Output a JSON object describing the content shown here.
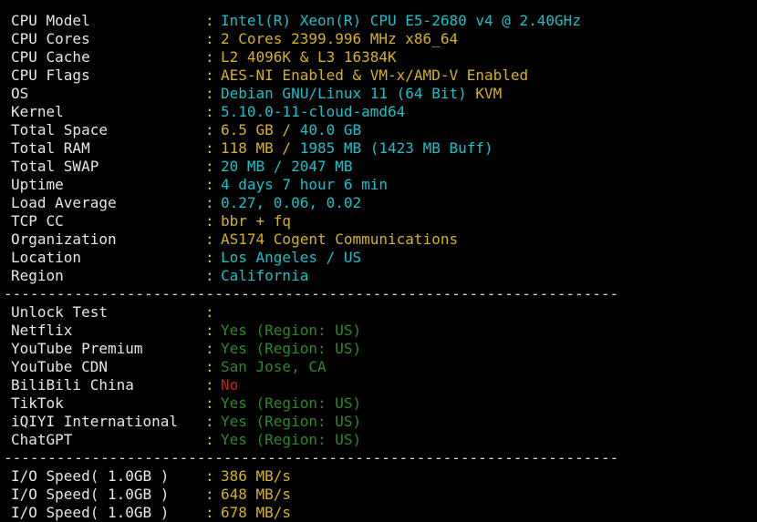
{
  "colors": {
    "background": "#000000",
    "key": "#e6e6e6",
    "colon": "#e0c020",
    "cyan": "#19c0c8",
    "yellow": "#d4b21c",
    "green": "#2a8a2a",
    "red": "#d81818"
  },
  "separator": "----------------------------------------------------------------------",
  "system": [
    {
      "key": "CPU Model",
      "segments": [
        {
          "t": "Intel(R) Xeon(R) CPU E5-2680 v4 @ 2.40GHz",
          "c": "cyan"
        }
      ]
    },
    {
      "key": "CPU Cores",
      "segments": [
        {
          "t": "2 Cores 2399.996 MHz x86_64",
          "c": "yellow"
        }
      ]
    },
    {
      "key": "CPU Cache",
      "segments": [
        {
          "t": "L2 4096K & L3 16384K",
          "c": "yellow"
        }
      ]
    },
    {
      "key": "CPU Flags",
      "segments": [
        {
          "t": "AES-NI Enabled & VM-x/AMD-V Enabled",
          "c": "yellow"
        }
      ]
    },
    {
      "key": "OS",
      "segments": [
        {
          "t": "Debian GNU/Linux 11 (64 Bit) ",
          "c": "cyan"
        },
        {
          "t": "KVM",
          "c": "yellow"
        }
      ]
    },
    {
      "key": "Kernel",
      "segments": [
        {
          "t": "5.10.0-11-cloud-amd64",
          "c": "cyan"
        }
      ]
    },
    {
      "key": "Total Space",
      "segments": [
        {
          "t": "6.5 GB / ",
          "c": "yellow"
        },
        {
          "t": "40.0 GB",
          "c": "cyan"
        }
      ]
    },
    {
      "key": "Total RAM",
      "segments": [
        {
          "t": "118 MB / ",
          "c": "yellow"
        },
        {
          "t": "1985 MB ",
          "c": "cyan"
        },
        {
          "t": "(1423 MB Buff)",
          "c": "cyan"
        }
      ]
    },
    {
      "key": "Total SWAP",
      "segments": [
        {
          "t": "20 MB / ",
          "c": "cyan"
        },
        {
          "t": "2047 MB",
          "c": "cyan"
        }
      ]
    },
    {
      "key": "Uptime",
      "segments": [
        {
          "t": "4 days 7 hour 6 min",
          "c": "cyan"
        }
      ]
    },
    {
      "key": "Load Average",
      "segments": [
        {
          "t": "0.27, 0.06, 0.02",
          "c": "cyan"
        }
      ]
    },
    {
      "key": "TCP CC",
      "segments": [
        {
          "t": "bbr + fq",
          "c": "yellow"
        }
      ]
    },
    {
      "key": "Organization",
      "segments": [
        {
          "t": "AS174 Cogent Communications",
          "c": "yellow"
        }
      ]
    },
    {
      "key": "Location",
      "segments": [
        {
          "t": "Los Angeles / US",
          "c": "cyan"
        }
      ]
    },
    {
      "key": "Region",
      "segments": [
        {
          "t": "California",
          "c": "cyan"
        }
      ]
    }
  ],
  "unlock": [
    {
      "key": "Unlock Test",
      "segments": []
    },
    {
      "key": "Netflix",
      "segments": [
        {
          "t": "Yes (Region: US)",
          "c": "green"
        }
      ]
    },
    {
      "key": "YouTube Premium",
      "segments": [
        {
          "t": "Yes (Region: US)",
          "c": "green"
        }
      ]
    },
    {
      "key": "YouTube CDN",
      "segments": [
        {
          "t": "San Jose, CA",
          "c": "green"
        }
      ]
    },
    {
      "key": "BiliBili China",
      "segments": [
        {
          "t": "No",
          "c": "red"
        }
      ]
    },
    {
      "key": "TikTok",
      "segments": [
        {
          "t": "Yes (Region: US)",
          "c": "green"
        }
      ]
    },
    {
      "key": "iQIYI International",
      "segments": [
        {
          "t": "Yes (Region: US)",
          "c": "green"
        }
      ]
    },
    {
      "key": "ChatGPT",
      "segments": [
        {
          "t": "Yes (Region: US)",
          "c": "green"
        }
      ]
    }
  ],
  "io": [
    {
      "key": "I/O Speed( 1.0GB )",
      "segments": [
        {
          "t": "386 MB/s",
          "c": "yellow"
        }
      ]
    },
    {
      "key": "I/O Speed( 1.0GB )",
      "segments": [
        {
          "t": "648 MB/s",
          "c": "yellow"
        }
      ]
    },
    {
      "key": "I/O Speed( 1.0GB )",
      "segments": [
        {
          "t": "678 MB/s",
          "c": "yellow"
        }
      ]
    }
  ]
}
